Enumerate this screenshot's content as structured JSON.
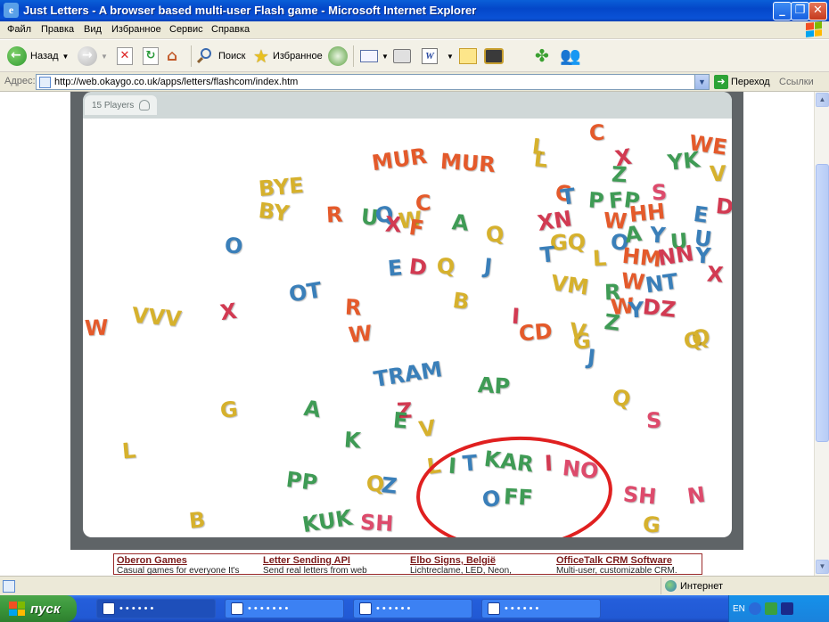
{
  "window": {
    "title": "Just Letters - A browser based multi-user Flash game - Microsoft Internet Explorer",
    "app_icon": "e",
    "controls": {
      "minimize": "_",
      "maximize": "❐",
      "close": "✕"
    }
  },
  "menu": [
    "Файл",
    "Правка",
    "Вид",
    "Избранное",
    "Сервис",
    "Справка"
  ],
  "toolbar": {
    "back": "Назад",
    "search": "Поиск",
    "favorites": "Избранное"
  },
  "address": {
    "label": "Адрес:",
    "url": "http://web.okaygo.co.uk/apps/letters/flashcom/index.htm",
    "go": "Переход",
    "links": "Ссылки"
  },
  "game": {
    "players": "15 Players",
    "colors": {
      "orange": "#e45a2b",
      "green": "#3f9b55",
      "blue": "#3a7fb9",
      "yellow": "#d6b12d",
      "red": "#d23a52",
      "pink": "#dd4b6c",
      "circle": "#e02020"
    },
    "letters": [
      {
        "t": "MUR",
        "c": "c-or"
      },
      {
        "t": "MUR",
        "c": "c-or"
      },
      {
        "t": "BYE",
        "c": "c-ye"
      },
      {
        "t": "BY",
        "c": "c-ye"
      },
      {
        "t": "R",
        "c": "c-or"
      },
      {
        "t": "U",
        "c": "c-gr"
      },
      {
        "t": "Q",
        "c": "c-bl"
      },
      {
        "t": "X",
        "c": "c-rd"
      },
      {
        "t": "W",
        "c": "c-ye"
      },
      {
        "t": "F",
        "c": "c-or"
      },
      {
        "t": "C",
        "c": "c-or"
      },
      {
        "t": "A",
        "c": "c-gr"
      },
      {
        "t": "Q",
        "c": "c-ye"
      },
      {
        "t": "O",
        "c": "c-bl"
      },
      {
        "t": "E",
        "c": "c-bl"
      },
      {
        "t": "D",
        "c": "c-rd"
      },
      {
        "t": "Q",
        "c": "c-ye"
      },
      {
        "t": "J",
        "c": "c-bl"
      },
      {
        "t": "OT",
        "c": "c-bl"
      },
      {
        "t": "R",
        "c": "c-or"
      },
      {
        "t": "W",
        "c": "c-or"
      },
      {
        "t": "B",
        "c": "c-ye"
      },
      {
        "t": "W",
        "c": "c-or"
      },
      {
        "t": "VVV",
        "c": "c-ye"
      },
      {
        "t": "X",
        "c": "c-rd"
      },
      {
        "t": "I",
        "c": "c-rd"
      },
      {
        "t": "CD",
        "c": "c-or"
      },
      {
        "t": "V",
        "c": "c-ye"
      },
      {
        "t": "G",
        "c": "c-ye"
      },
      {
        "t": "J",
        "c": "c-bl"
      },
      {
        "t": "TRAM",
        "c": "c-bl"
      },
      {
        "t": "AP",
        "c": "c-gr"
      },
      {
        "t": "G",
        "c": "c-ye"
      },
      {
        "t": "A",
        "c": "c-gr"
      },
      {
        "t": "Z",
        "c": "c-rd"
      },
      {
        "t": "E",
        "c": "c-gr"
      },
      {
        "t": "V",
        "c": "c-ye"
      },
      {
        "t": "K",
        "c": "c-gr"
      },
      {
        "t": "L",
        "c": "c-ye"
      },
      {
        "t": "PP",
        "c": "c-gr"
      },
      {
        "t": "Q",
        "c": "c-ye"
      },
      {
        "t": "Z",
        "c": "c-bl"
      },
      {
        "t": "KUK",
        "c": "c-gr"
      },
      {
        "t": "SH",
        "c": "c-pk"
      },
      {
        "t": "B",
        "c": "c-ye"
      },
      {
        "t": "Q",
        "c": "c-ye"
      },
      {
        "t": "S",
        "c": "c-pk"
      },
      {
        "t": "SH",
        "c": "c-pk"
      },
      {
        "t": "N",
        "c": "c-pk"
      },
      {
        "t": "G",
        "c": "c-ye"
      },
      {
        "t": "Q",
        "c": "c-ye"
      },
      {
        "t": "L",
        "c": "c-ye"
      },
      {
        "t": "C",
        "c": "c-or"
      },
      {
        "t": "L",
        "c": "c-ye"
      },
      {
        "t": "X",
        "c": "c-rd"
      },
      {
        "t": "Z",
        "c": "c-gr"
      },
      {
        "t": "YK",
        "c": "c-gr"
      },
      {
        "t": "WE",
        "c": "c-or"
      },
      {
        "t": "V",
        "c": "c-ye"
      },
      {
        "t": "C",
        "c": "c-or"
      },
      {
        "t": "T",
        "c": "c-bl"
      },
      {
        "t": "P",
        "c": "c-gr"
      },
      {
        "t": "F",
        "c": "c-gr"
      },
      {
        "t": "P",
        "c": "c-gr"
      },
      {
        "t": "S",
        "c": "c-pk"
      },
      {
        "t": "D",
        "c": "c-rd"
      },
      {
        "t": "XN",
        "c": "c-rd"
      },
      {
        "t": "W",
        "c": "c-or"
      },
      {
        "t": "HH",
        "c": "c-or"
      },
      {
        "t": "E",
        "c": "c-bl"
      },
      {
        "t": "GQ",
        "c": "c-ye"
      },
      {
        "t": "O",
        "c": "c-bl"
      },
      {
        "t": "A",
        "c": "c-gr"
      },
      {
        "t": "Y",
        "c": "c-bl"
      },
      {
        "t": "U",
        "c": "c-gr"
      },
      {
        "t": "U",
        "c": "c-bl"
      },
      {
        "t": "L",
        "c": "c-ye"
      },
      {
        "t": "HM",
        "c": "c-or"
      },
      {
        "t": "NN",
        "c": "c-rd"
      },
      {
        "t": "Y",
        "c": "c-bl"
      },
      {
        "t": "T",
        "c": "c-bl"
      },
      {
        "t": "VM",
        "c": "c-ye"
      },
      {
        "t": "R",
        "c": "c-gr"
      },
      {
        "t": "W",
        "c": "c-or"
      },
      {
        "t": "NT",
        "c": "c-bl"
      },
      {
        "t": "X",
        "c": "c-rd"
      },
      {
        "t": "W",
        "c": "c-or"
      },
      {
        "t": "Z",
        "c": "c-gr"
      },
      {
        "t": "Y",
        "c": "c-bl"
      },
      {
        "t": "DZ",
        "c": "c-rd"
      },
      {
        "t": "Q",
        "c": "c-ye"
      }
    ],
    "highlighted": [
      {
        "t": "L",
        "c": "c-ye"
      },
      {
        "t": "I",
        "c": "c-gr"
      },
      {
        "t": "T",
        "c": "c-bl"
      },
      {
        "t": "KAR",
        "c": "c-gr"
      },
      {
        "t": "I",
        "c": "c-rd"
      },
      {
        "t": "NO",
        "c": "c-pk"
      },
      {
        "t": "O",
        "c": "c-bl"
      },
      {
        "t": "FF",
        "c": "c-gr"
      }
    ]
  },
  "ads": [
    {
      "title": "Oberon Games",
      "desc": "Casual games for everyone It's"
    },
    {
      "title": "Letter Sending API",
      "desc": "Send real letters from web"
    },
    {
      "title": "Elbo Signs, België",
      "desc": "Lichtreclame, LED, Neon,"
    },
    {
      "title": "OfficeTalk CRM Software",
      "desc": "Multi-user, customizable CRM."
    }
  ],
  "status": {
    "zone": "Интернет"
  },
  "taskbar": {
    "start": "пуск",
    "tasks": [
      "• • •  •  •  •",
      "• •  • • • •  •",
      "• •  •  •  • •",
      "• • •  •  •  •"
    ],
    "tray_lang": "EN"
  }
}
